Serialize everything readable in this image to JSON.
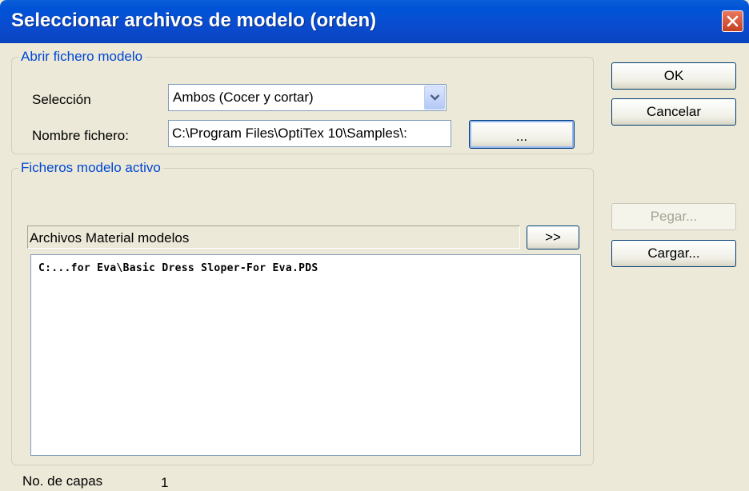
{
  "window": {
    "title": "Seleccionar archivos de modelo (orden)",
    "close_icon": "close-x-icon",
    "accent": "#0a4bcf"
  },
  "open_model_group": {
    "legend": "Abrir fichero modelo",
    "selection_label": "Selección",
    "selection_value": "Ambos (Cocer y cortar)",
    "filename_label": "Nombre fichero:",
    "filename_value": "C:\\Program Files\\OptiTex 10\\Samples\\:",
    "browse_label": "..."
  },
  "active_model_group": {
    "legend": "Ficheros modelo activo",
    "header_label": "Archivos Material modelos",
    "expand_label": ">>",
    "files": [
      "C:...for Eva\\Basic Dress Sloper-For Eva.PDS"
    ]
  },
  "side_buttons": {
    "ok": "OK",
    "cancel": "Cancelar",
    "paste": "Pegar...",
    "load": "Cargar..."
  },
  "footer": {
    "layers_label": "No. de capas",
    "layers_value": "1"
  }
}
